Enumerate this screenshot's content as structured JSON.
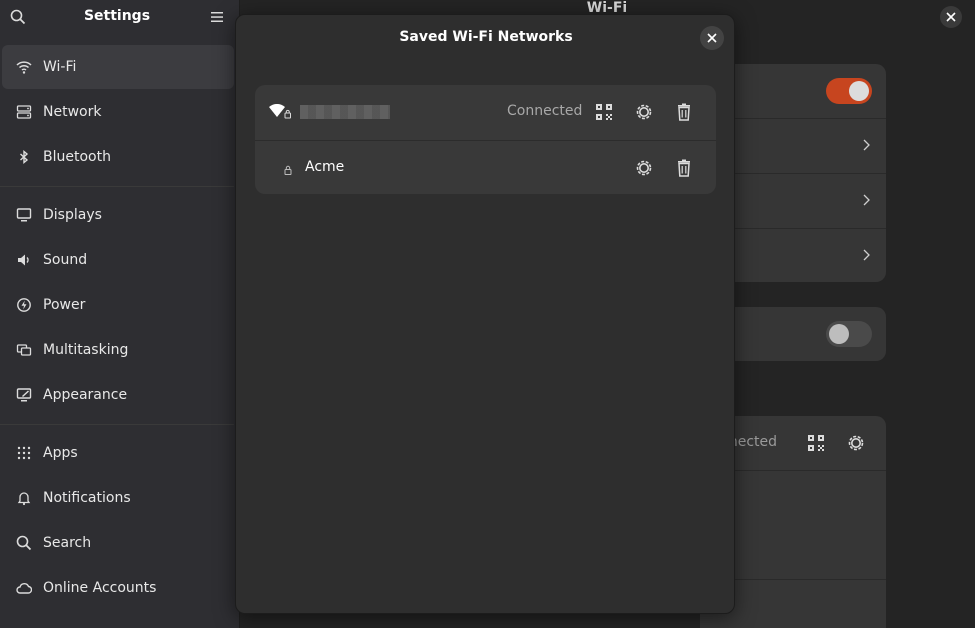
{
  "sidebar": {
    "title": "Settings",
    "items": [
      {
        "label": "Wi-Fi",
        "icon": "wifi-icon",
        "active": true
      },
      {
        "label": "Network",
        "icon": "network-icon"
      },
      {
        "label": "Bluetooth",
        "icon": "bluetooth-icon"
      },
      {
        "label": "Displays",
        "icon": "display-icon"
      },
      {
        "label": "Sound",
        "icon": "speaker-icon"
      },
      {
        "label": "Power",
        "icon": "power-icon"
      },
      {
        "label": "Multitasking",
        "icon": "multitasking-icon"
      },
      {
        "label": "Appearance",
        "icon": "appearance-icon"
      },
      {
        "label": "Apps",
        "icon": "apps-grid-icon"
      },
      {
        "label": "Notifications",
        "icon": "bell-icon"
      },
      {
        "label": "Search",
        "icon": "search-icon"
      },
      {
        "label": "Online Accounts",
        "icon": "cloud-icon"
      }
    ]
  },
  "main": {
    "title": "Wi-Fi",
    "background_status": "nnected"
  },
  "dialog": {
    "title": "Saved Wi-Fi Networks",
    "networks": [
      {
        "name": "",
        "status": "Connected"
      },
      {
        "name": "Acme",
        "status": ""
      }
    ]
  },
  "colors": {
    "accent": "#c7451f",
    "dialog_bg": "#2e2e2e",
    "list_bg": "#393939",
    "sidebar_bg": "#2e2e32"
  }
}
